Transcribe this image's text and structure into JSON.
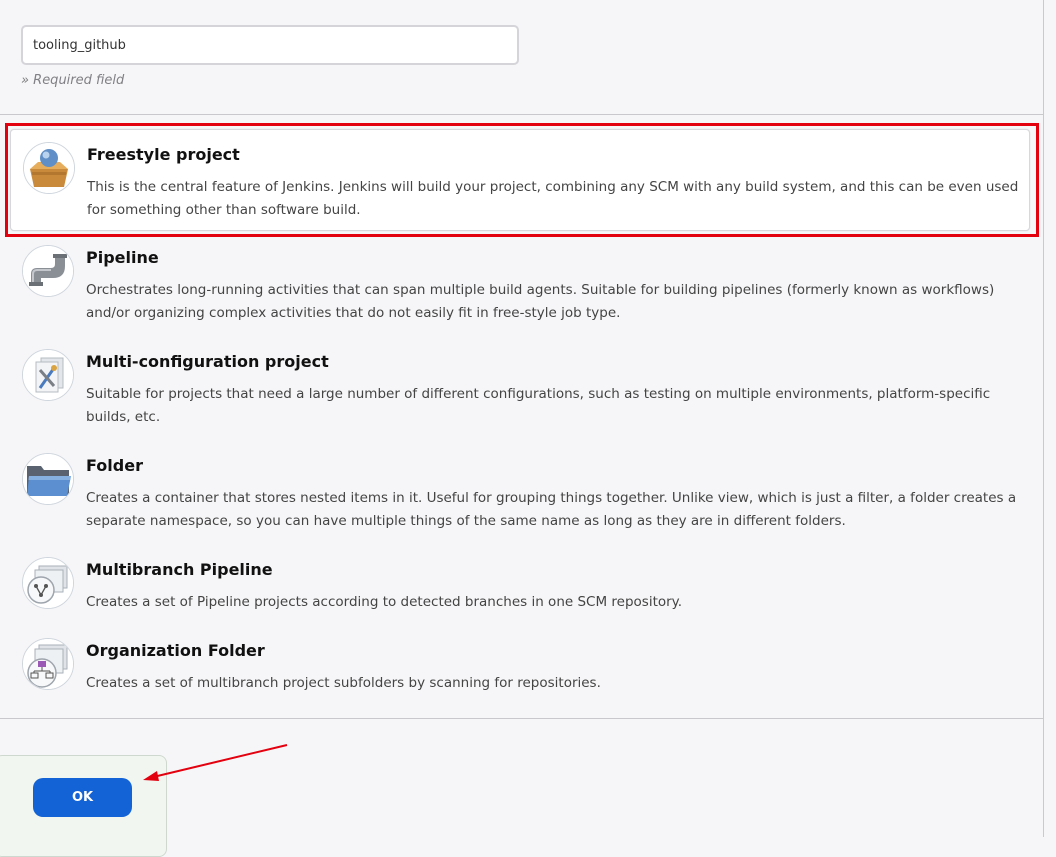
{
  "item_name": {
    "value": "tooling_github",
    "required_note": "» Required field"
  },
  "job_types": [
    {
      "title": "Freestyle project",
      "description": "This is the central feature of Jenkins. Jenkins will build your project, combining any SCM with any build system, and this can be even used for something other than software build.",
      "icon": "freestyle-project-icon",
      "selected": true
    },
    {
      "title": "Pipeline",
      "description": "Orchestrates long-running activities that can span multiple build agents. Suitable for building pipelines (formerly known as workflows) and/or organizing complex activities that do not easily fit in free-style job type.",
      "icon": "pipeline-icon",
      "selected": false
    },
    {
      "title": "Multi-configuration project",
      "description": "Suitable for projects that need a large number of different configurations, such as testing on multiple environments, platform-specific builds, etc.",
      "icon": "multi-configuration-icon",
      "selected": false
    },
    {
      "title": "Folder",
      "description": "Creates a container that stores nested items in it. Useful for grouping things together. Unlike view, which is just a filter, a folder creates a separate namespace, so you can have multiple things of the same name as long as they are in different folders.",
      "icon": "folder-icon",
      "selected": false
    },
    {
      "title": "Multibranch Pipeline",
      "description": "Creates a set of Pipeline projects according to detected branches in one SCM repository.",
      "icon": "multibranch-pipeline-icon",
      "selected": false
    },
    {
      "title": "Organization Folder",
      "description": "Creates a set of multibranch project subfolders by scanning for repositories.",
      "icon": "organization-folder-icon",
      "selected": false
    }
  ],
  "actions": {
    "ok_label": "OK"
  },
  "colors": {
    "accent": "#1363d6",
    "highlight": "#e3000f"
  }
}
